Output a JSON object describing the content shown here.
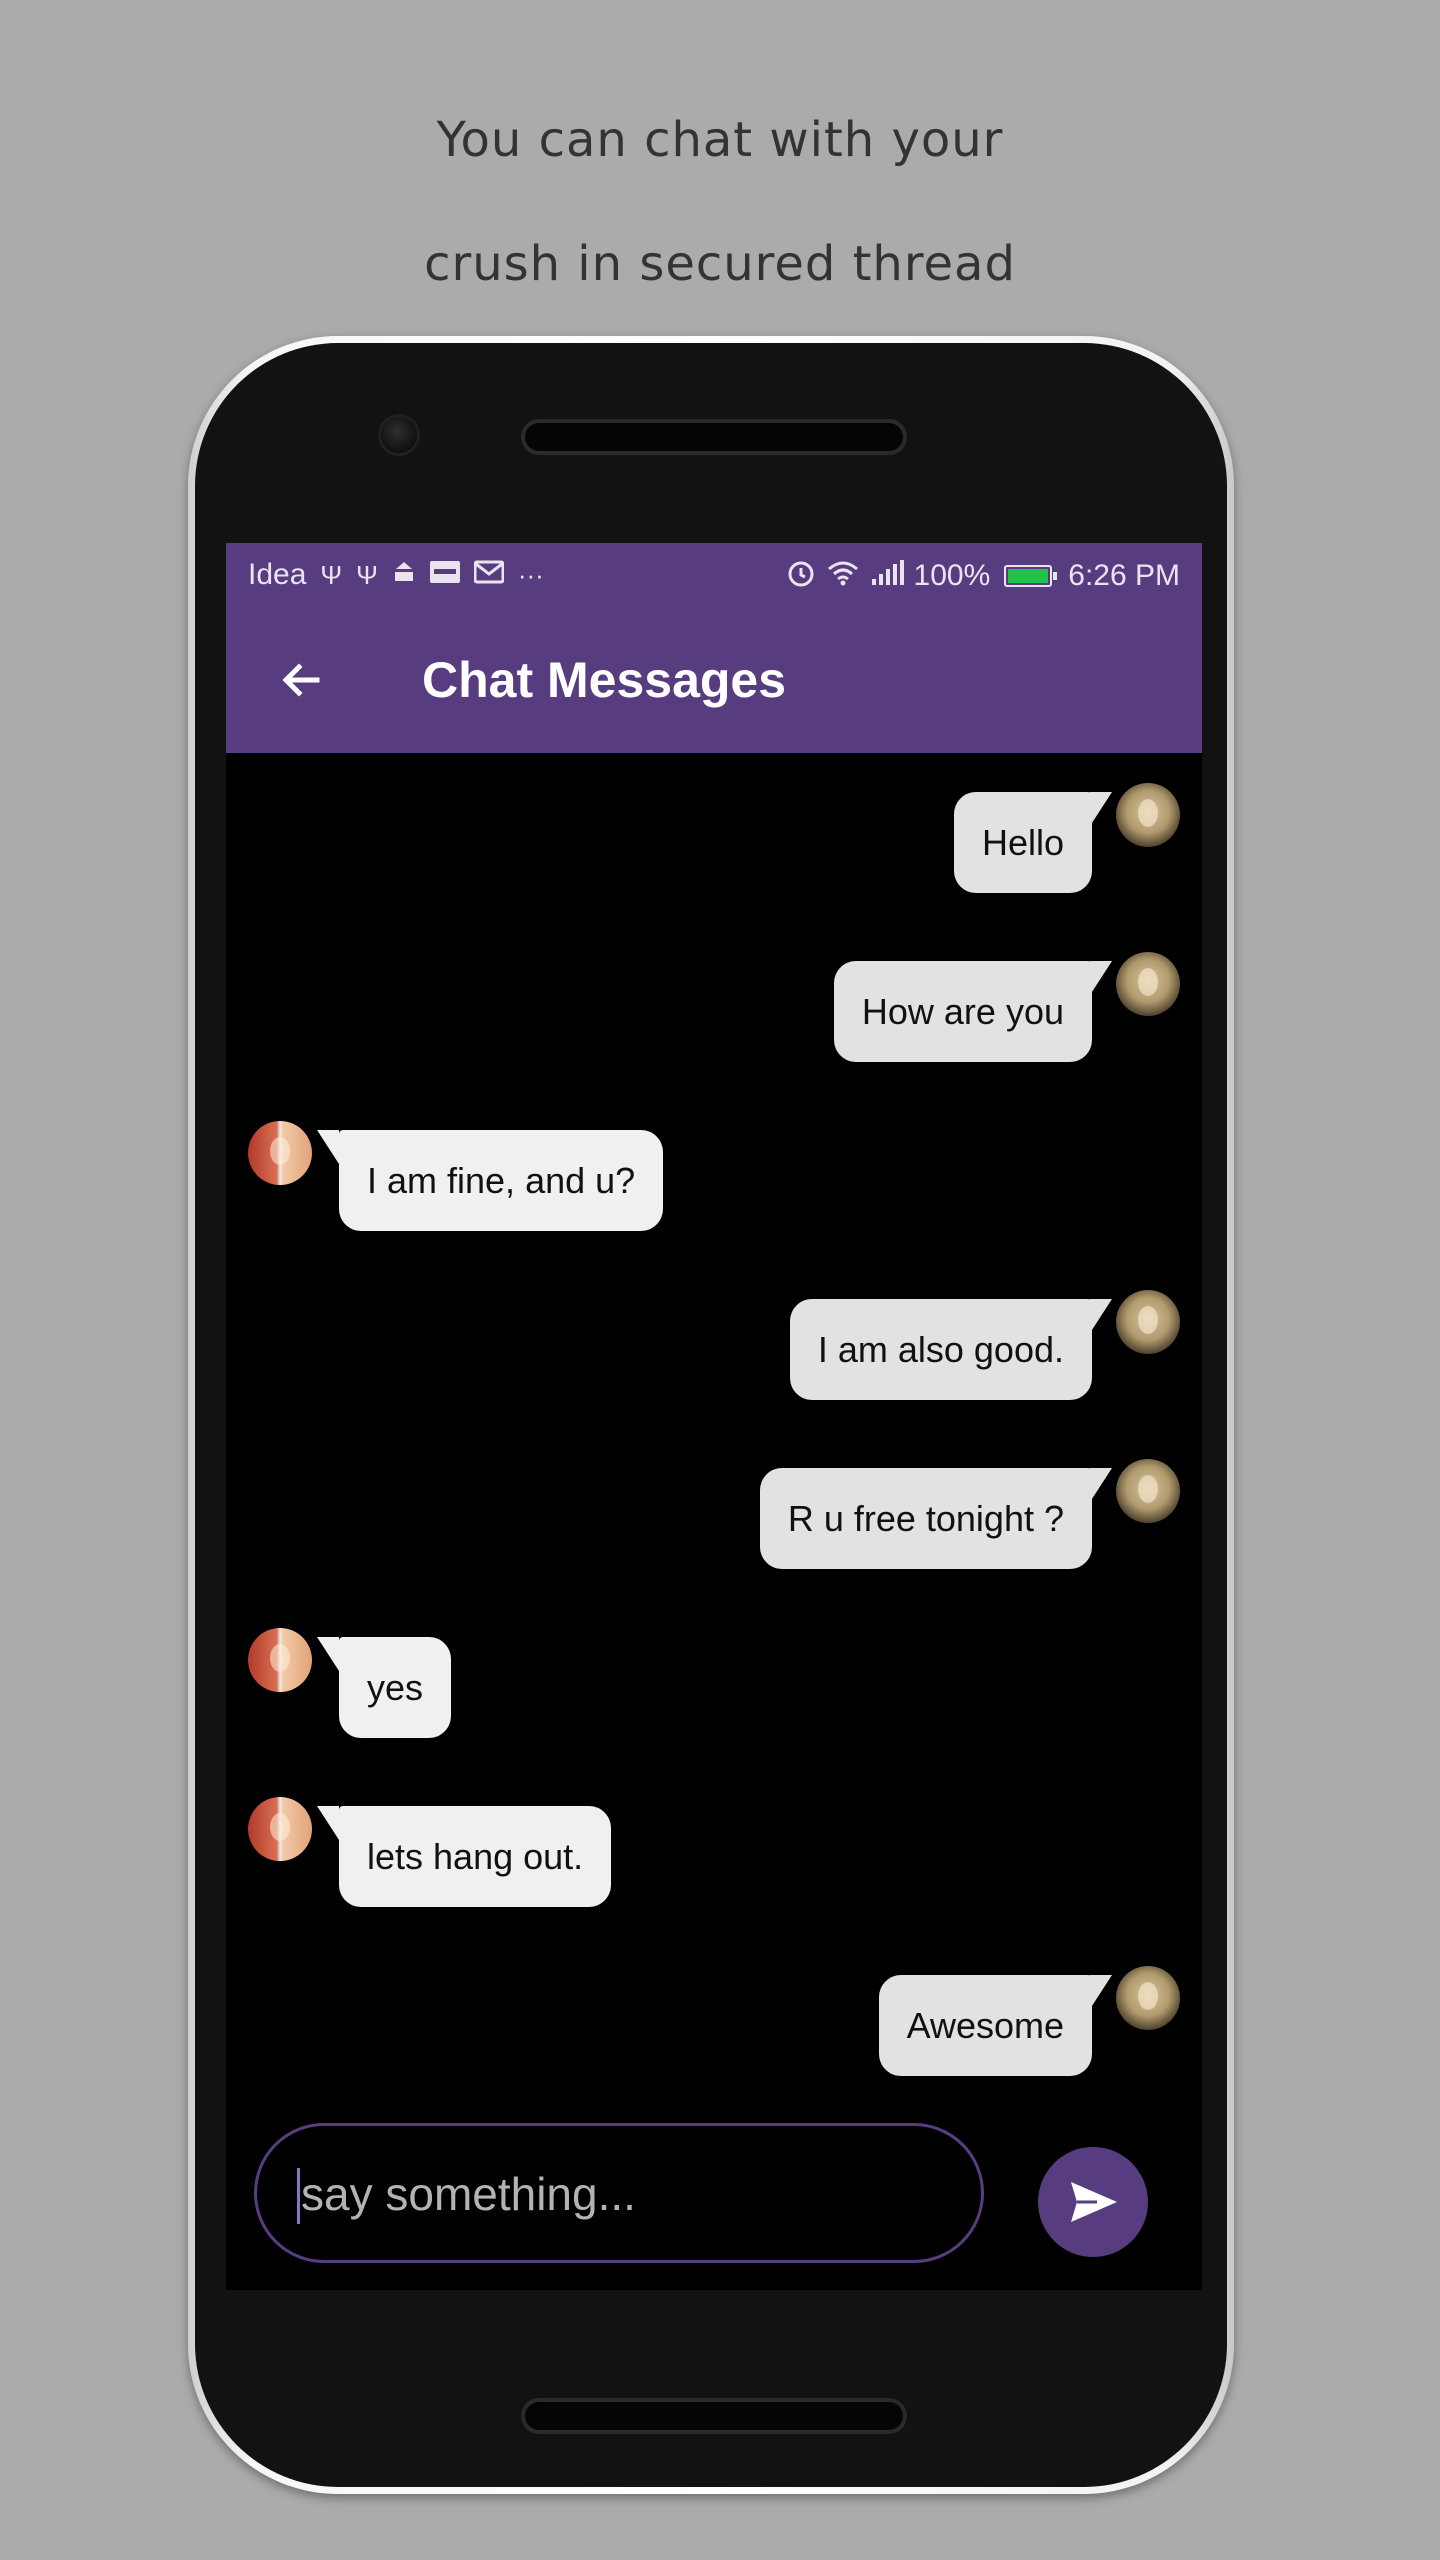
{
  "promo": {
    "line1": "You can chat with your",
    "line2": "crush in secured thread"
  },
  "status_bar": {
    "carrier": "Idea",
    "battery_percent": "100%",
    "time": "6:26 PM",
    "left_icons": [
      "usb-icon",
      "usb-icon",
      "download-icon",
      "paytm-icon",
      "gmail-icon",
      "more-dots-icon"
    ],
    "right_icons": [
      "alarm-icon",
      "wifi-icon",
      "signal-icon",
      "battery-icon"
    ],
    "battery_color": "#22c24a"
  },
  "app_bar": {
    "title": "Chat Messages",
    "back_icon": "arrow-back-icon",
    "color": "#573d7f"
  },
  "messages": [
    {
      "text": "Hello",
      "side": "sent"
    },
    {
      "text": "How are you",
      "side": "sent"
    },
    {
      "text": "I am fine, and u?",
      "side": "received"
    },
    {
      "text": "I am also good.",
      "side": "sent"
    },
    {
      "text": "R u free tonight  ?",
      "side": "sent"
    },
    {
      "text": "yes",
      "side": "received"
    },
    {
      "text": "lets hang out.",
      "side": "received"
    },
    {
      "text": "Awesome",
      "side": "sent"
    }
  ],
  "composer": {
    "placeholder": "say something...",
    "value": "",
    "send_icon": "send-icon"
  }
}
